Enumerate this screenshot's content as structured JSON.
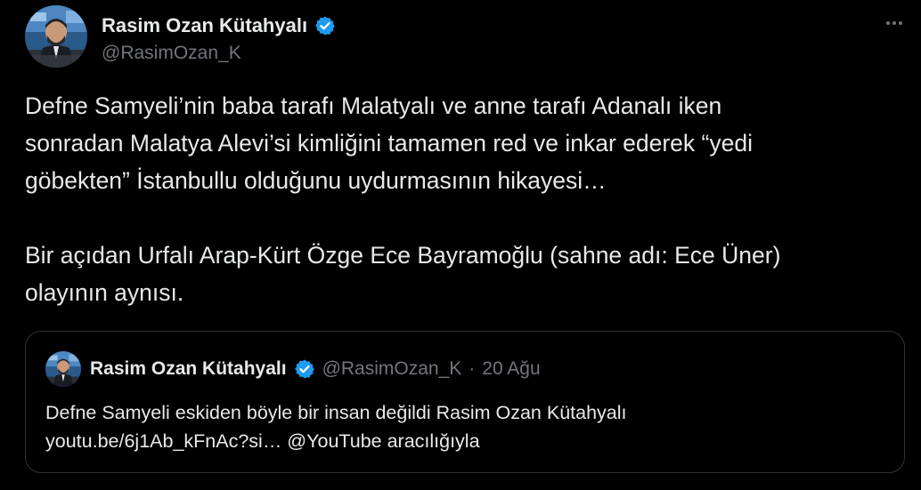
{
  "author": {
    "display_name": "Rasim Ozan Kütahyalı",
    "handle": "@RasimOzan_K",
    "verified_icon": "verified-badge-icon",
    "avatar_icon": "avatar-photo"
  },
  "more_icon": "more-options-icon",
  "tweet": {
    "paragraph_1": "Defne Samyeli’nin baba tarafı Malatyalı ve anne tarafı Adanalı iken\nsonradan Malatya Alevi’si kimliğini tamamen red ve inkar ederek “yedi\ngöbekten” İstanbullu olduğunu uydurmasının hikayesi…",
    "paragraph_2": "Bir açıdan Urfalı Arap-Kürt Özge Ece Bayramoğlu (sahne adı: Ece Üner)\nolayının aynısı."
  },
  "quoted_tweet": {
    "display_name": "Rasim Ozan Kütahyalı",
    "handle": "@RasimOzan_K",
    "separator": "·",
    "date": "20 Ağu",
    "line_1": "Defne Samyeli eskiden böyle bir insan değildi Rasim Ozan Kütahyalı",
    "line_2": "youtu.be/6j1Ab_kFnAc?si… @YouTube aracılığıyla"
  },
  "colors": {
    "background": "#000000",
    "text_primary": "#e7e9ea",
    "text_secondary": "#71767b",
    "verified_blue": "#1d9bf0",
    "border": "#2f3336"
  }
}
